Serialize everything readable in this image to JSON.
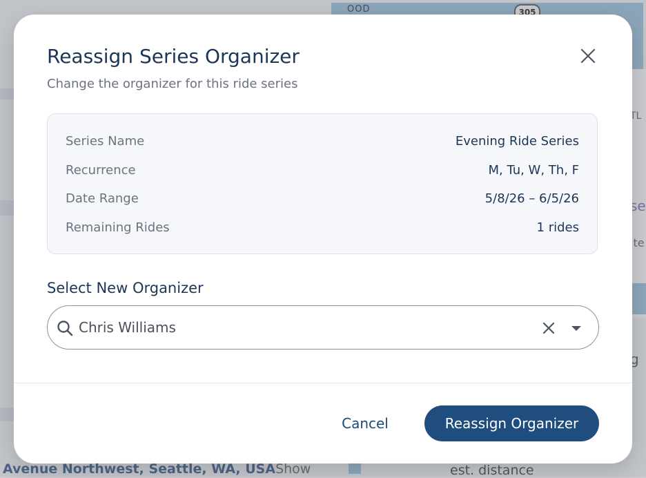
{
  "background": {
    "map_label": "OOD",
    "route_shield": "305",
    "side_text_1": "TL",
    "side_text_2": "se",
    "side_text_3": "ite",
    "side_text_4": "g",
    "address": "Avenue Northwest, Seattle, WA, USA",
    "show_link": "Show",
    "est_distance": "est. distance"
  },
  "modal": {
    "title": "Reassign Series Organizer",
    "subtitle": "Change the organizer for this ride series",
    "close_icon": "close-icon",
    "details": [
      {
        "label": "Series Name",
        "value": "Evening Ride Series"
      },
      {
        "label": "Recurrence",
        "value": "M, Tu, W, Th, F"
      },
      {
        "label": "Date Range",
        "value": "5/8/26 – 6/5/26"
      },
      {
        "label": "Remaining Rides",
        "value": "1 rides"
      }
    ],
    "select_label": "Select New Organizer",
    "search": {
      "value": "Chris Williams",
      "placeholder": "",
      "icons": [
        "search-icon",
        "clear-icon",
        "chevron-down-icon"
      ]
    },
    "buttons": {
      "cancel": "Cancel",
      "submit": "Reassign Organizer"
    }
  },
  "colors": {
    "primary": "#1f4e7e",
    "title": "#1d3557",
    "muted": "#6b7280"
  }
}
